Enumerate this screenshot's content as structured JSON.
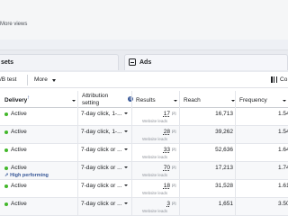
{
  "header": {
    "more_views": "More views"
  },
  "tabs": [
    {
      "label": "sets"
    },
    {
      "label": "Ads",
      "icon": "ads-icon"
    }
  ],
  "toolbar": {
    "ab_test": "/B test",
    "more": "More",
    "columns": "Co"
  },
  "table": {
    "columns": {
      "delivery": "Delivery",
      "attribution": [
        "Attribution",
        "setting"
      ],
      "results": "Results",
      "reach": "Reach",
      "frequency": "Frequency"
    },
    "rows": [
      {
        "status": "Active",
        "attribution": "7-day click, 1-...",
        "results": "17",
        "results_sup": "[2]",
        "results_sub": "Website leads",
        "reach": "16,713",
        "frequency": "1.54"
      },
      {
        "status": "Active",
        "attribution": "7-day click, 1-...",
        "results": "28",
        "results_sup": "[2]",
        "results_sub": "Website leads",
        "reach": "39,262",
        "frequency": "1.54"
      },
      {
        "status": "Active",
        "attribution": "7-day click or ...",
        "results": "33",
        "results_sup": "[2]",
        "results_sub": "Website leads",
        "reach": "52,636",
        "frequency": "1.64"
      },
      {
        "status": "Active",
        "attribution": "7-day click or ...",
        "results": "70",
        "results_sup": "[2]",
        "results_sub": "Website leads",
        "reach": "17,213",
        "frequency": "1.74",
        "badge": "High performing"
      },
      {
        "status": "Active",
        "attribution": "7-day click or ...",
        "results": "18",
        "results_sup": "[2]",
        "results_sub": "Website leads",
        "reach": "31,528",
        "frequency": "1.61"
      },
      {
        "status": "Active",
        "attribution": "7-day click or ...",
        "results": "3",
        "results_sup": "[2]",
        "results_sub": "Website leads",
        "reach": "1,651",
        "frequency": "3.50"
      }
    ]
  },
  "colors": {
    "active": "#42b72a",
    "link": "#385898"
  }
}
